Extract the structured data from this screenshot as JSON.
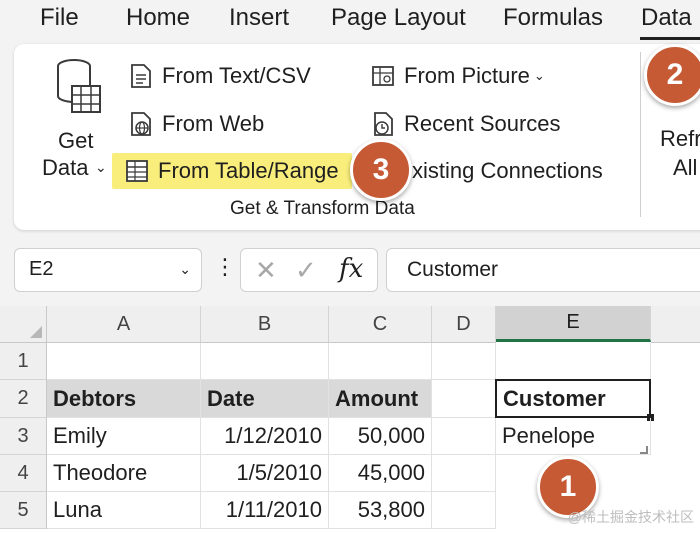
{
  "menu": {
    "tabs": [
      "File",
      "Home",
      "Insert",
      "Page Layout",
      "Formulas",
      "Data"
    ],
    "active_tab": "Data"
  },
  "ribbon": {
    "get_data": {
      "label_line1": "Get",
      "label_line2": "Data"
    },
    "items": {
      "from_text_csv": "From Text/CSV",
      "from_web": "From Web",
      "from_table_range": "From Table/Range",
      "from_picture": "From Picture",
      "recent_sources": "Recent Sources",
      "existing_connections": "xisting Connections"
    },
    "group_label": "Get & Transform Data",
    "refresh_line1": "Refr",
    "refresh_line2": "All"
  },
  "callouts": {
    "one": "1",
    "two": "2",
    "three": "3"
  },
  "formula_bar": {
    "name_box": "E2",
    "dots": "⋮",
    "cancel": "✕",
    "enter": "✓",
    "fx": "fx",
    "content": "Customer"
  },
  "grid": {
    "columns": [
      "A",
      "B",
      "C",
      "D",
      "E"
    ],
    "selected_column": "E",
    "rows": [
      "1",
      "2",
      "3",
      "4",
      "5"
    ],
    "table_headers": [
      "Debtors",
      "Date",
      "Amount"
    ],
    "table_rows": [
      [
        "Emily",
        "1/12/2010",
        "50,000"
      ],
      [
        "Theodore",
        "1/5/2010",
        "45,000"
      ],
      [
        "Luna",
        "1/11/2010",
        "53,800"
      ]
    ],
    "criteria_header": "Customer",
    "criteria_value": "Penelope"
  },
  "watermark": "@稀土掘金技术社区",
  "colors": {
    "accent_green": "#217346",
    "callout": "#c55a35",
    "highlight": "#f9ee7c"
  }
}
